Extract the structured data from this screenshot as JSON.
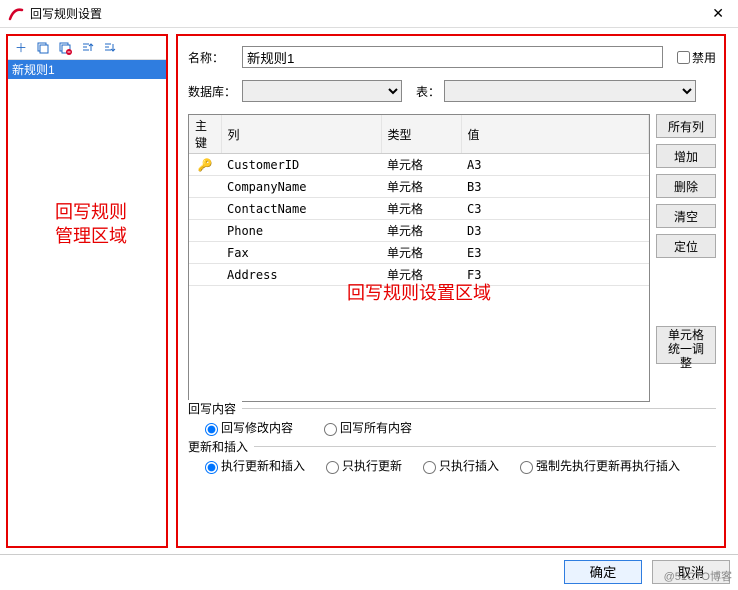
{
  "window": {
    "title": "回写规则设置",
    "close": "✕"
  },
  "left": {
    "caption": "回写规则\n管理区域",
    "rules": [
      {
        "label": "新规则1"
      }
    ],
    "icons": {
      "add": "＋",
      "copy": "⿻",
      "delete": "⿻",
      "sort_asc": "⇡",
      "sort_desc": "⇣"
    }
  },
  "right": {
    "caption": "回写规则设置区域",
    "name_label": "名称：",
    "name_value": "新规则1",
    "disable_label": "禁用",
    "db_label": "数据库：",
    "db_value": "",
    "table_label": "表：",
    "table_value": "",
    "grid": {
      "headers": {
        "pk": "主键",
        "col": "列",
        "type": "类型",
        "val": "值"
      },
      "rows": [
        {
          "pk": "🔑",
          "col": "CustomerID",
          "type": "单元格",
          "val": "A3"
        },
        {
          "pk": "",
          "col": "CompanyName",
          "type": "单元格",
          "val": "B3"
        },
        {
          "pk": "",
          "col": "ContactName",
          "type": "单元格",
          "val": "C3"
        },
        {
          "pk": "",
          "col": "Phone",
          "type": "单元格",
          "val": "D3"
        },
        {
          "pk": "",
          "col": "Fax",
          "type": "单元格",
          "val": "E3"
        },
        {
          "pk": "",
          "col": "Address",
          "type": "单元格",
          "val": "F3"
        }
      ]
    },
    "side_buttons": {
      "all_cols": "所有列",
      "add": "增加",
      "delete": "删除",
      "clear": "清空",
      "locate": "定位",
      "cell_adjust": "单元格统一调整"
    },
    "group1": {
      "title": "回写内容",
      "opt1": "回写修改内容",
      "opt2": "回写所有内容",
      "selected": "opt1"
    },
    "group2": {
      "title": "更新和插入",
      "opt1": "执行更新和插入",
      "opt2": "只执行更新",
      "opt3": "只执行插入",
      "opt4": "强制先执行更新再执行插入",
      "selected": "opt1"
    }
  },
  "footer": {
    "ok": "确定",
    "cancel": "取消"
  },
  "watermark": "@51CTO博客"
}
